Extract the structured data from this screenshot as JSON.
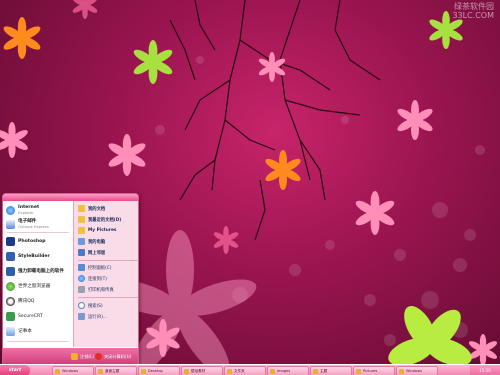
{
  "watermark": {
    "line1": "绿茶软件园",
    "line2": "33LC.COM"
  },
  "start_menu": {
    "pinned": [
      {
        "label": "Internet",
        "sub": "Explorer",
        "icon": "ie-icon"
      },
      {
        "label": "电子邮件",
        "sub": "Outlook Express",
        "icon": "mail-icon"
      }
    ],
    "recent": [
      {
        "label": "Photoshop",
        "icon": "photoshop-icon"
      },
      {
        "label": "StyleBuilder",
        "icon": "stylebuilder-icon"
      },
      {
        "label": "强力卸载电脑上的软件",
        "icon": "uninstall-icon"
      },
      {
        "label": "世界之窗浏览器",
        "icon": "browser-icon"
      },
      {
        "label": "腾讯QQ",
        "icon": "qq-icon"
      },
      {
        "label": "SecureCRT",
        "icon": "securecrt-icon"
      },
      {
        "label": "记事本",
        "icon": "notepad-icon"
      }
    ],
    "all_programs": "所有程序(P)",
    "right_items": [
      {
        "label": "我的文档",
        "icon": "my-documents-icon"
      },
      {
        "label": "我最近的文档(D)",
        "icon": "recent-docs-icon"
      },
      {
        "label": "My Pictures",
        "icon": "my-pictures-icon"
      },
      {
        "label": "我的电脑",
        "icon": "my-computer-icon"
      },
      {
        "label": "网上邻居",
        "icon": "network-icon"
      },
      {
        "label": "控制面板(C)",
        "icon": "control-panel-icon"
      },
      {
        "label": "连接到(T)",
        "icon": "connect-icon"
      },
      {
        "label": "打印机和传真",
        "icon": "printer-icon"
      },
      {
        "label": "搜索(S)",
        "icon": "search-icon"
      },
      {
        "label": "运行(R)...",
        "icon": "run-icon"
      }
    ],
    "logoff": "注销(L)",
    "shutdown": "关闭计算机(U)"
  },
  "taskbar": {
    "start_label": "start",
    "tasks": [
      "Windows",
      "桌面主题",
      "Desktop",
      "壁纸素材",
      "文件夹",
      "Images",
      "主题",
      "Pictures",
      "Windows"
    ],
    "tray_text": "15:36"
  },
  "colors": {
    "accent": "#e84c8a",
    "background": "#9b1550"
  }
}
